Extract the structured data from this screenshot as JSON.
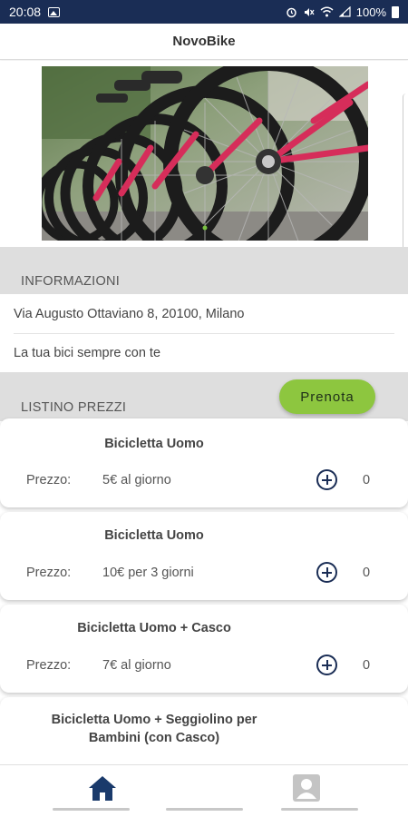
{
  "status_bar": {
    "time": "20:08",
    "battery_text": "100%"
  },
  "header": {
    "title": "NovoBike"
  },
  "info": {
    "section_label": "INFORMAZIONI",
    "address": "Via Augusto Ottaviano 8, 20100, Milano",
    "tagline": "La tua bici sempre con te"
  },
  "prices": {
    "section_label": "LISTINO PREZZI",
    "book_button": "Prenota",
    "price_label": "Prezzo:",
    "items": [
      {
        "title": "Bicicletta Uomo",
        "price": "5€ al giorno",
        "quantity": "0"
      },
      {
        "title": "Bicicletta Uomo",
        "price": "10€ per 3 giorni",
        "quantity": "0"
      },
      {
        "title": "Bicicletta Uomo + Casco",
        "price": "7€ al giorno",
        "quantity": "0"
      },
      {
        "title": "Bicicletta Uomo + Seggiolino per Bambini (con Casco)"
      }
    ]
  },
  "nav": {
    "items": [
      {
        "icon": "home-icon",
        "active": true
      },
      {
        "icon": "profile-icon",
        "active": false
      }
    ]
  },
  "colors": {
    "status_bar": "#1a2d55",
    "accent_green": "#8dc63f",
    "icon_navy": "#1a2d55",
    "section_bg": "#dedede"
  }
}
